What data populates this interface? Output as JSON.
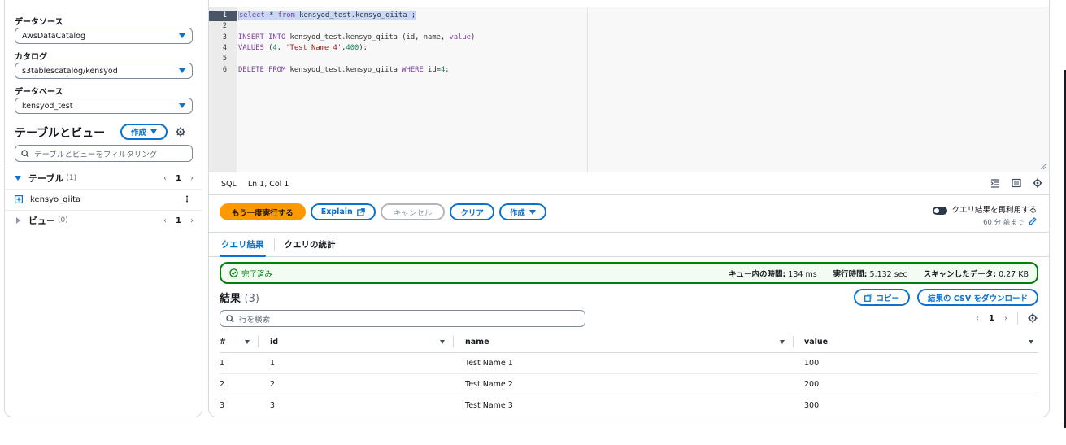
{
  "sidebar": {
    "datasource_label": "データソース",
    "datasource_value": "AwsDataCatalog",
    "catalog_label": "カタログ",
    "catalog_value": "s3tablescatalog/kensyod",
    "database_label": "データベース",
    "database_value": "kensyod_test",
    "tables_title": "テーブルとビュー",
    "create_label": "作成",
    "filter_placeholder": "テーブルとビューをフィルタリング",
    "tables_section": "テーブル",
    "tables_count": "(1)",
    "tables_page": "1",
    "table_item": "kensyo_qiita",
    "views_section": "ビュー",
    "views_count": "(0)",
    "views_page": "1"
  },
  "editor": {
    "lines": [
      {
        "num": "1",
        "text": "select * from kensyod_test.kensyo_qiita ;"
      },
      {
        "num": "2",
        "text": ""
      },
      {
        "num": "3",
        "text": "INSERT INTO kensyod_test.kensyo_qiita (id, name, value)"
      },
      {
        "num": "4",
        "text": "VALUES (4, 'Test Name 4',400);"
      },
      {
        "num": "5",
        "text": ""
      },
      {
        "num": "6",
        "text": "DELETE FROM kensyod_test.kensyo_qiita WHERE id=4;"
      }
    ],
    "language": "SQL",
    "cursor": "Ln 1, Col 1"
  },
  "actions": {
    "rerun": "もう一度実行する",
    "explain": "Explain",
    "cancel": "キャンセル",
    "clear": "クリア",
    "create": "作成",
    "reuse_label": "クエリ結果を再利用する",
    "reuse_sub": "60 分 前まで"
  },
  "tabs": {
    "results": "クエリ結果",
    "stats": "クエリの統計"
  },
  "status": {
    "state": "完了済み",
    "queue_label": "キュー内の時間:",
    "queue_value": "134 ms",
    "exec_label": "実行時間:",
    "exec_value": "5.132 sec",
    "scan_label": "スキャンしたデータ:",
    "scan_value": "0.27 KB"
  },
  "results": {
    "title": "結果",
    "count": "(3)",
    "copy": "コピー",
    "download": "結果の CSV をダウンロード",
    "search_placeholder": "行を検索",
    "page": "1",
    "columns": [
      "#",
      "id",
      "name",
      "value"
    ],
    "rows": [
      [
        "1",
        "1",
        "Test Name 1",
        "100"
      ],
      [
        "2",
        "2",
        "Test Name 2",
        "200"
      ],
      [
        "3",
        "3",
        "Test Name 3",
        "300"
      ]
    ]
  },
  "colors": {
    "accent": "#0972d3",
    "primary_button": "#ff9900",
    "success": "#037f0c"
  }
}
